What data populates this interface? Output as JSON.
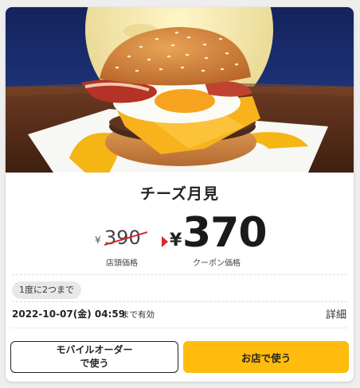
{
  "product": {
    "name": "チーズ月見",
    "image_alt": "cheese-tsukimi-burger"
  },
  "pricing": {
    "old_currency": "¥",
    "old_price": "390",
    "old_label": "店頭価格",
    "new_currency": "¥",
    "new_price": "370",
    "new_label": "クーポン価格"
  },
  "limit": {
    "text": "1度に2つまで"
  },
  "expiry": {
    "date": "2022-10-07(金) 04:59",
    "suffix": "まで有効"
  },
  "details": {
    "label": "詳細"
  },
  "actions": {
    "mobile_order_line1": "モバイルオーダー",
    "mobile_order_line2": "で使う",
    "in_store": "お店で使う"
  },
  "colors": {
    "primary_button": "#ffbc0d",
    "strike": "#d9282d",
    "arrow": "#d9282d",
    "chip_bg": "#e8e8e8"
  }
}
